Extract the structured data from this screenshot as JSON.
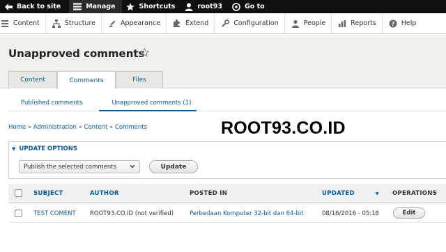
{
  "toolbar": {
    "back_to_site": "Back to site",
    "manage": "Manage",
    "shortcuts": "Shortcuts",
    "user": "root93",
    "go_to": "Go to"
  },
  "admin_menu": [
    {
      "label": "Content",
      "icon": "content-icon"
    },
    {
      "label": "Structure",
      "icon": "structure-icon"
    },
    {
      "label": "Appearance",
      "icon": "appearance-icon"
    },
    {
      "label": "Extend",
      "icon": "extend-icon"
    },
    {
      "label": "Configuration",
      "icon": "configuration-icon"
    },
    {
      "label": "People",
      "icon": "people-icon"
    },
    {
      "label": "Reports",
      "icon": "reports-icon"
    },
    {
      "label": "Help",
      "icon": "help-icon"
    }
  ],
  "page": {
    "title": "Unapproved comments",
    "tabs": [
      "Content",
      "Comments",
      "Files"
    ],
    "subtabs": [
      "Published comments",
      "Unapproved comments (1)"
    ],
    "breadcrumb": [
      "Home",
      "Administration",
      "Content",
      "Comments"
    ],
    "watermark": "ROOT93.CO.ID"
  },
  "update_options": {
    "title": "UPDATE OPTIONS",
    "select_value": "Publish the selected comments",
    "button": "Update"
  },
  "table": {
    "headers": {
      "subject": "SUBJECT",
      "author": "AUTHOR",
      "posted_in": "POSTED IN",
      "updated": "UPDATED",
      "operations": "OPERATIONS"
    },
    "rows": [
      {
        "subject": "TEST COMENT",
        "author": "ROOT93.CO.ID (not verified)",
        "posted_in": "Perbedaan Komputer 32-bit dan 64-bit",
        "updated": "08/16/2016 - 05:18",
        "operation": "Edit"
      }
    ]
  },
  "colors": {
    "link": "#0a5c9c",
    "toolbar_bg": "#0f0f0f",
    "header_bg": "#f1f0ed"
  }
}
